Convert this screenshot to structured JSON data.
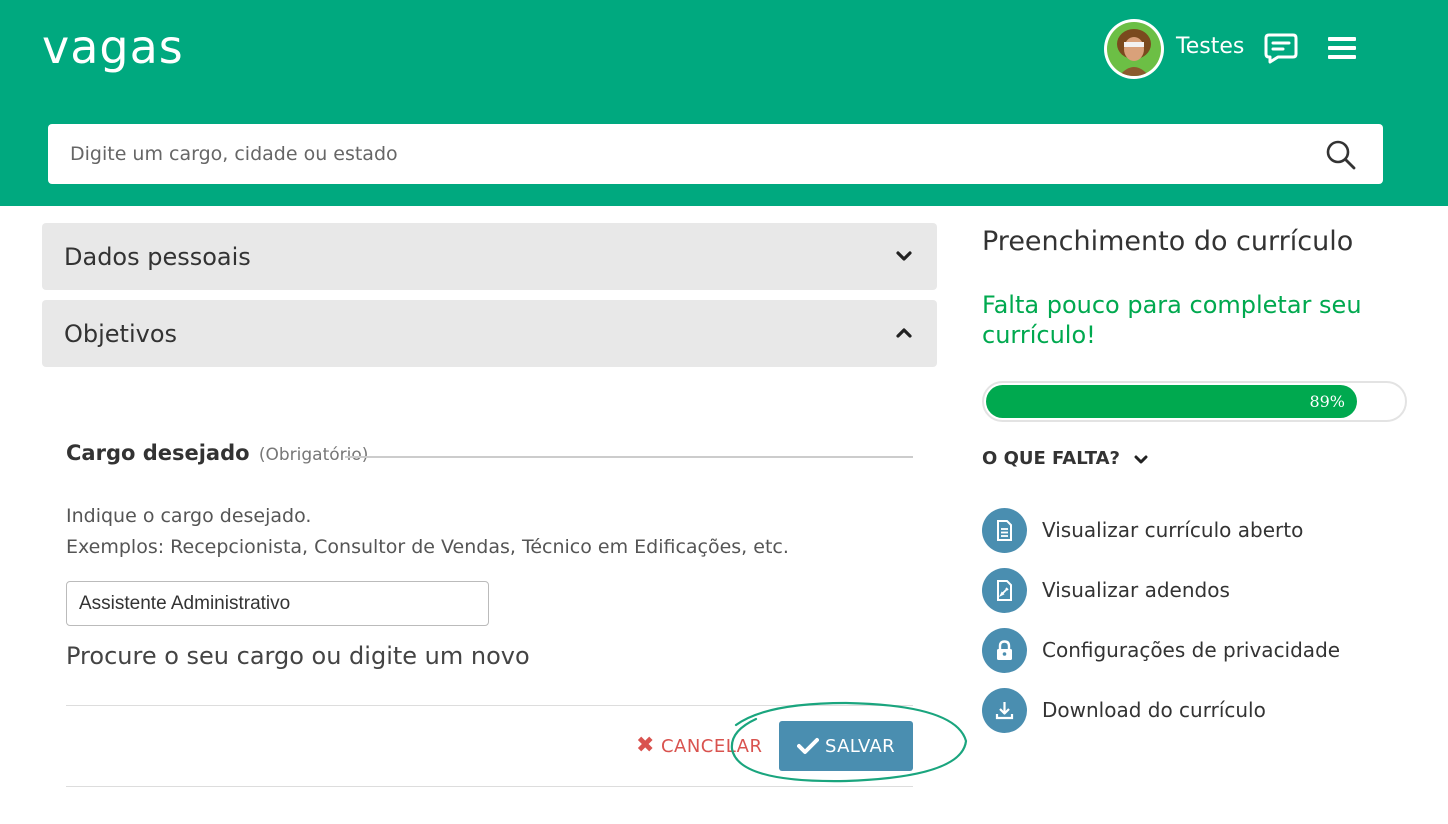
{
  "header": {
    "logo": "vagas",
    "username": "Testes",
    "search_placeholder": "Digite um cargo, cidade ou estado",
    "colors": {
      "brand": "#00a97f"
    }
  },
  "accordions": [
    {
      "title": "Dados pessoais",
      "state": "collapsed",
      "icon": "chevron-down-icon"
    },
    {
      "title": "Objetivos",
      "state": "expanded",
      "icon": "chevron-up-icon"
    }
  ],
  "form": {
    "label": "Cargo desejado",
    "required": "(Obrigatório)",
    "instruction_1": "Indique o cargo desejado.",
    "instruction_2": "Exemplos: Recepcionista, Consultor de Vendas, Técnico em Edificações, etc.",
    "cargo_value": "Assistente Administrativo",
    "hint": "Procure o seu cargo ou digite um novo",
    "cancel_label": "CANCELAR",
    "save_label": "SALVAR",
    "colors": {
      "cancel": "#d9534f",
      "save": "#4a8eb0"
    }
  },
  "panel": {
    "title": "Preenchimento do currículo",
    "subtitle": "Falta pouco para completar seu currículo!",
    "progress_value": 89,
    "progress_text": "89%",
    "missing_label": "O QUE FALTA?",
    "links": [
      {
        "label": "Visualizar currículo aberto",
        "icon": "document-icon"
      },
      {
        "label": "Visualizar adendos",
        "icon": "addendum-icon"
      },
      {
        "label": "Configurações de privacidade",
        "icon": "lock-icon"
      },
      {
        "label": "Download do currículo",
        "icon": "download-icon"
      }
    ],
    "colors": {
      "progress": "#00a94f",
      "subtitle": "#00a94f",
      "link_icon": "#4a8eb0"
    }
  }
}
